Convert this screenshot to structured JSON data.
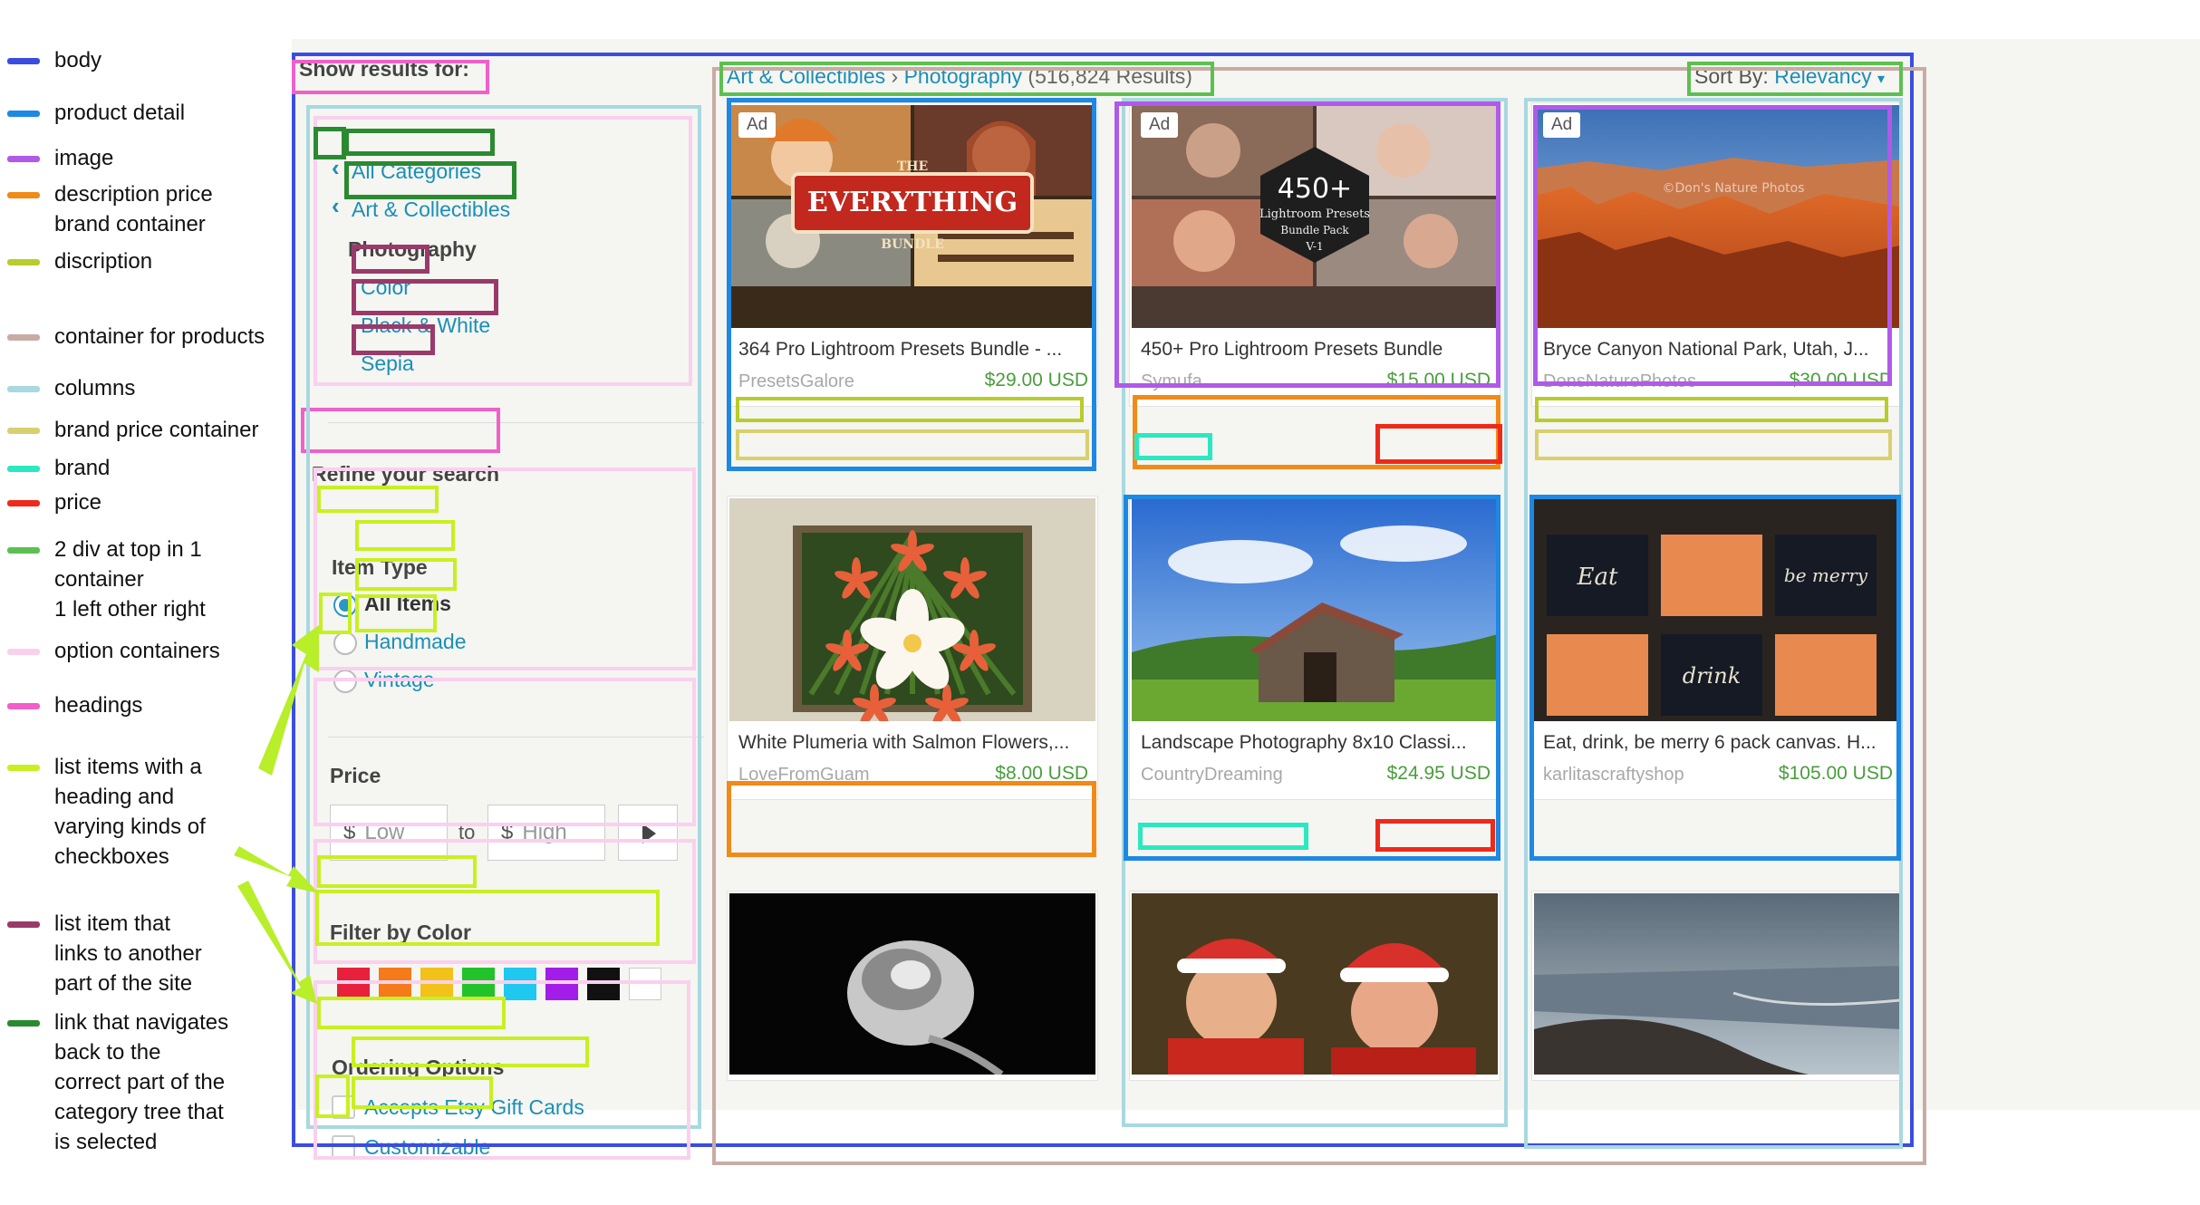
{
  "legend": [
    {
      "text": "body",
      "color": "#3a4de0"
    },
    {
      "text": "product detail",
      "color": "#1e88e5"
    },
    {
      "text": "image",
      "color": "#b05ae8"
    },
    {
      "text": "description price\nbrand container",
      "color": "#f08a18"
    },
    {
      "text": "discription",
      "color": "#b8cc2c"
    },
    {
      "text": "container for products",
      "color": "#c8aca4"
    },
    {
      "text": "columns",
      "color": "#a8d8e0"
    },
    {
      "text": "brand price container",
      "color": "#d8d070"
    },
    {
      "text": "brand",
      "color": "#2ce8c0"
    },
    {
      "text": "price",
      "color": "#ee2a1a"
    },
    {
      "text": "2 div at top in 1\ncontainer\n1 left other right",
      "color": "#5cc050"
    },
    {
      "text": "option containers",
      "color": "#fad0ee"
    },
    {
      "text": "headings",
      "color": "#f060c8"
    },
    {
      "text": "list items with a\nheading and\nvarying kinds of\ncheckboxes",
      "color": "#c8f020"
    },
    {
      "text": "list item that\nlinks to another\npart of the site",
      "color": "#9a3a6a"
    },
    {
      "text": "link that navigates\nback to the\ncorrect part of the\ncategory tree that\nis selected",
      "color": "#2a8a30"
    }
  ],
  "filters": {
    "show_results_for": "Show results for:",
    "all_categories": "All Categories",
    "art_collectibles": "Art & Collectibles",
    "current_category": "Photography",
    "subcategories": [
      "Color",
      "Black & White",
      "Sepia"
    ],
    "refine": "Refine your search",
    "item_type": {
      "heading": "Item Type",
      "options": [
        "All Items",
        "Handmade",
        "Vintage"
      ],
      "selected": "All Items"
    },
    "price": {
      "heading": "Price",
      "currency": "$",
      "low_placeholder": "Low",
      "high_placeholder": "High",
      "to": "to"
    },
    "color": {
      "heading": "Filter by Color",
      "swatches": [
        "#e8203c",
        "#f47a1a",
        "#f2c11a",
        "#22c22a",
        "#1ec8ee",
        "#a21ee8",
        "#111111",
        "#ffffff"
      ]
    },
    "ordering": {
      "heading": "Ordering Options",
      "options": [
        "Accepts Etsy Gift Cards",
        "Customizable"
      ]
    }
  },
  "header": {
    "crumb_1": "Art & Collectibles",
    "crumb_sep": "›",
    "crumb_2": "Photography",
    "results": "(516,824 Results)",
    "sort_label": "Sort By:",
    "sort_value": "Relevancy"
  },
  "products": [
    {
      "ad": "Ad",
      "title": "364 Pro Lightroom Presets Bundle - ...",
      "shop": "PresetsGalore",
      "price": "$29.00 USD",
      "art": "collage"
    },
    {
      "ad": "Ad",
      "title": "450+ Pro Lightroom Presets Bundle",
      "shop": "Symufa",
      "price": "$15.00 USD",
      "art": "portraits"
    },
    {
      "ad": "Ad",
      "title": "Bryce Canyon National Park, Utah, J...",
      "shop": "DonsNaturePhotos",
      "price": "$30.00 USD",
      "art": "canyon"
    },
    {
      "ad": "",
      "title": "White Plumeria with Salmon Flowers,...",
      "shop": "LoveFromGuam",
      "price": "$8.00 USD",
      "art": "plumeria"
    },
    {
      "ad": "",
      "title": "Landscape Photography 8x10 Classi...",
      "shop": "CountryDreaming",
      "price": "$24.95 USD",
      "art": "barn"
    },
    {
      "ad": "",
      "title": "Eat, drink, be merry 6 pack canvas. H...",
      "shop": "karlitascraftyshop",
      "price": "$105.00 USD",
      "art": "canvas"
    },
    {
      "ad": "",
      "title": "",
      "shop": "",
      "price": "",
      "art": "rose"
    },
    {
      "ad": "",
      "title": "",
      "shop": "",
      "price": "",
      "art": "santa"
    },
    {
      "ad": "",
      "title": "",
      "shop": "",
      "price": "",
      "art": "coast"
    }
  ],
  "art_text": {
    "collage_1": "THE",
    "collage_2": "EVERYTHING",
    "collage_3": "BUNDLE",
    "portraits_1": "450+",
    "portraits_2": "Lightroom Presets",
    "portraits_3": "Bundle Pack",
    "portraits_4": "V-1",
    "canyon_watermark": "©Don's Nature Photos",
    "canvas_1": "Eat",
    "canvas_2": "be merry",
    "canvas_3": "drink"
  }
}
